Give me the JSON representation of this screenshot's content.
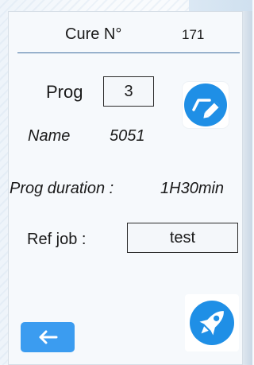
{
  "header": {
    "cure_label": "Cure N°",
    "cure_value": "171"
  },
  "program": {
    "prog_label": "Prog",
    "prog_value": "3",
    "name_label": "Name",
    "name_value": "5051",
    "duration_label": "Prog duration :",
    "duration_value": "1H30min"
  },
  "ref_job": {
    "label": "Ref job :",
    "value": "test"
  },
  "icons": {
    "edit": "edit-icon",
    "rocket": "rocket-icon",
    "back": "arrow-left-icon"
  },
  "colors": {
    "accent_blue": "#1f8fe6",
    "back_button": "#3b9cf0",
    "divider": "#3f6f9f"
  }
}
